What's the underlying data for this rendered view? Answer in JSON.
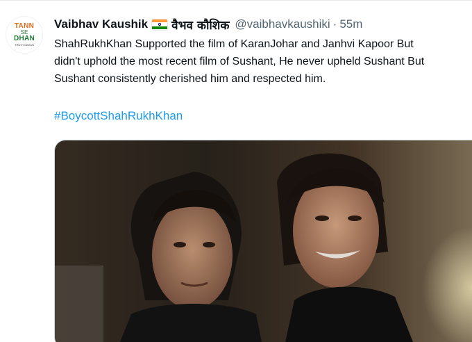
{
  "tweet": {
    "author": {
      "display_name": "Vaibhav Kaushik",
      "flag_icon": "india-flag-icon",
      "name_hindi": "वैभव कौशिक",
      "handle": "@vaibhavkaushiki",
      "separator": "·",
      "time_ago": "55m",
      "avatar": {
        "line1": "TANN",
        "line_mid": "SE",
        "line2": "DHAN",
        "line3": "TRUST INDIAN"
      }
    },
    "text_lines": [
      "ShahRukhKhan Supported the film of KaranJohar and Janhvi Kapoor But",
      "didn't uphold the most recent film of Sushant, He never upheld Sushant But",
      "Sushant consistently cherished him and respected him."
    ],
    "hashtag": "#BoycottShahRukhKhan",
    "media": {
      "description_icon": "photo-media"
    }
  },
  "colors": {
    "text": "#0f1419",
    "muted": "#536471",
    "link": "#1d9bf0",
    "border": "#cfd9de"
  }
}
